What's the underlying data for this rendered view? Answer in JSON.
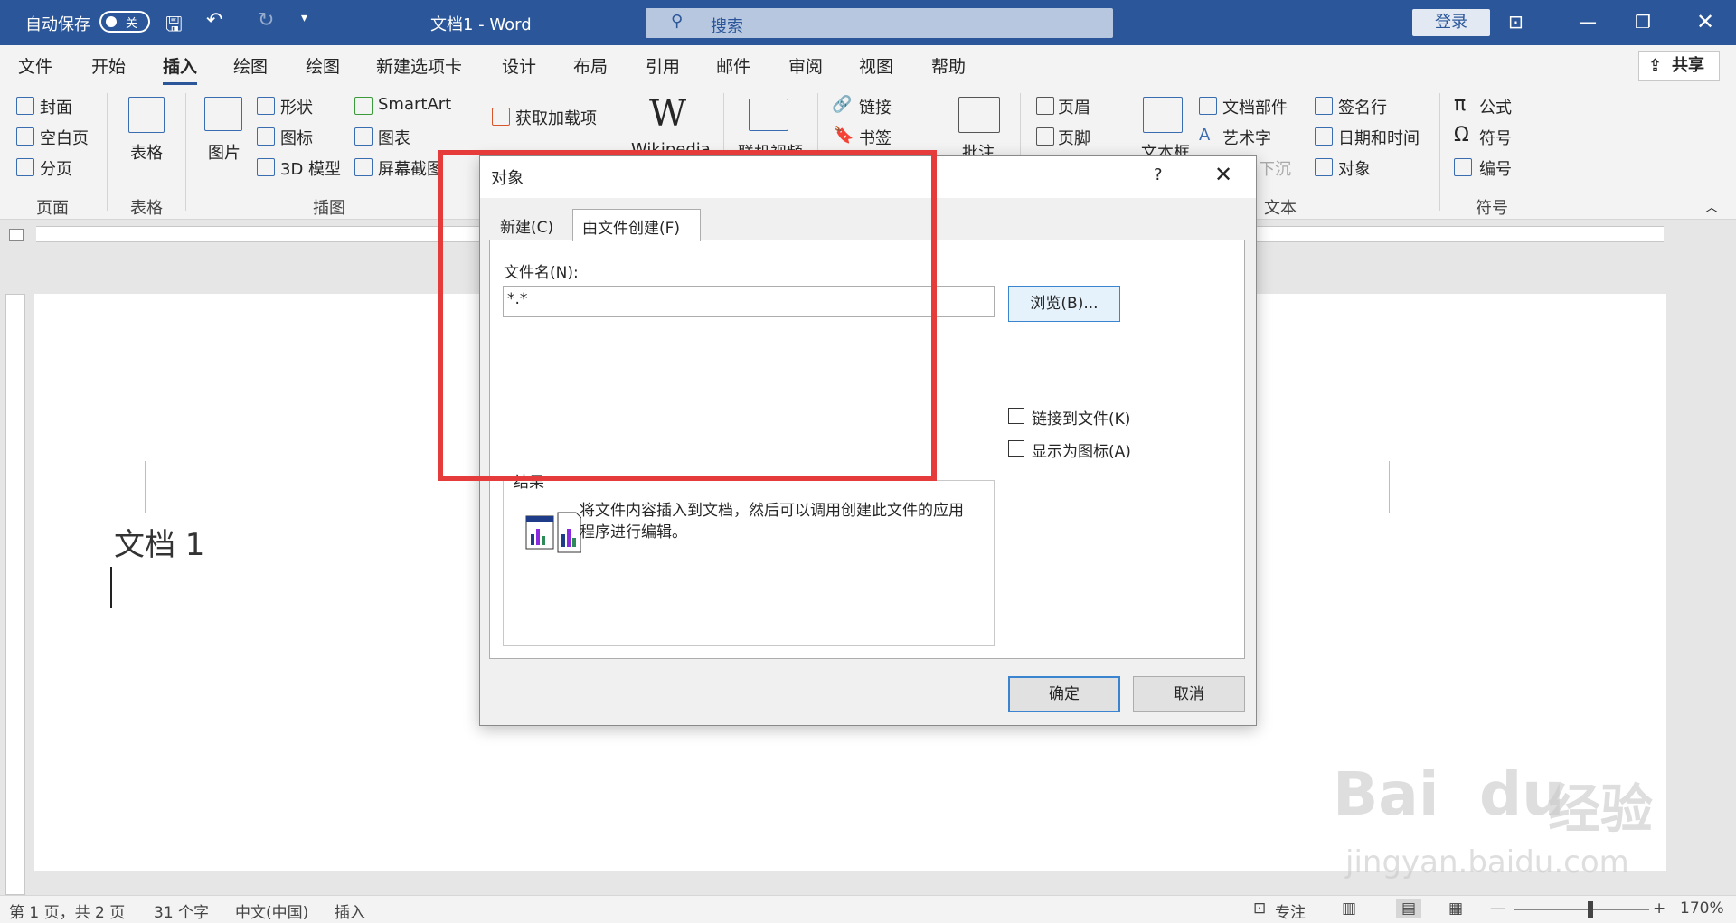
{
  "titlebar": {
    "autosave_label": "自动保存",
    "autosave_state": "关",
    "doc_title": "文档1 - Word",
    "search_placeholder": "搜索",
    "login": "登录"
  },
  "tabs": [
    "文件",
    "开始",
    "插入",
    "绘图",
    "绘图",
    "新建选项卡",
    "设计",
    "布局",
    "引用",
    "邮件",
    "审阅",
    "视图",
    "帮助"
  ],
  "active_tab": "插入",
  "share": "共享",
  "ribbon": {
    "page": {
      "cover": "封面",
      "blank": "空白页",
      "break": "分页",
      "group": "页面"
    },
    "table": {
      "label": "表格",
      "group": "表格"
    },
    "illustrations": {
      "picture": "图片",
      "shapes": "形状",
      "icons": "图标",
      "model3d": "3D 模型",
      "smartart": "SmartArt",
      "chart": "图表",
      "screenshot": "屏幕截图",
      "group": "插图"
    },
    "addins": {
      "get": "获取加载项",
      "wikipedia": "Wikipedia"
    },
    "media": {
      "online_video": "联机视频"
    },
    "links": {
      "link": "链接",
      "bookmark": "书签"
    },
    "comments": {
      "comment": "批注"
    },
    "header_footer": {
      "header": "页眉",
      "footer": "页脚"
    },
    "text": {
      "textbox": "文本框",
      "quickparts": "文档部件",
      "wordart": "艺术字",
      "dropcap": "下沉",
      "signature": "签名行",
      "datetime": "日期和时间",
      "object": "对象",
      "group": "文本"
    },
    "symbols": {
      "equation": "公式",
      "symbol": "符号",
      "number": "编号",
      "group": "符号"
    }
  },
  "document": {
    "heading": "文档 1"
  },
  "dialog": {
    "title": "对象",
    "help": "?",
    "tab_new": "新建(C)",
    "tab_from_file": "由文件创建(F)",
    "filename_label": "文件名(N):",
    "filename_value": "*.*",
    "browse": "浏览(B)...",
    "link_to_file": "链接到文件(K)",
    "display_as_icon": "显示为图标(A)",
    "result_label": "结果",
    "result_text": "将文件内容插入到文档，然后可以调用创建此文件的应用程序进行编辑。",
    "ok": "确定",
    "cancel": "取消"
  },
  "statusbar": {
    "page": "第 1 页，共 2 页",
    "words": "31 个字",
    "language": "中文(中国)",
    "mode": "插入",
    "focus": "专注",
    "zoom": "170%"
  },
  "watermark": {
    "brand": "Bai",
    "brand2": "du",
    "jingyan": "经验",
    "url": "jingyan.baidu.com"
  }
}
